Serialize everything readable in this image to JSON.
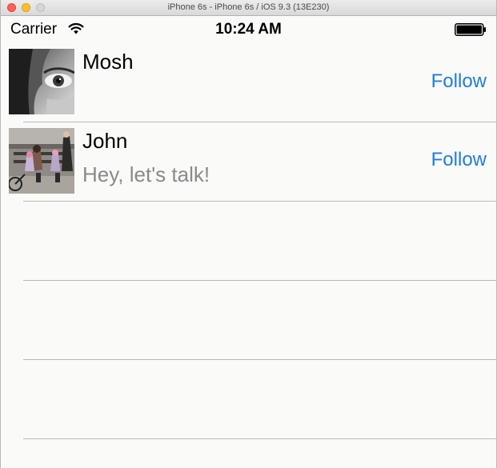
{
  "window": {
    "title": "iPhone 6s - iPhone 6s / iOS 9.3 (13E230)"
  },
  "statusbar": {
    "carrier": "Carrier",
    "time": "10:24 AM",
    "wifi_icon": "wifi-icon",
    "battery_icon": "battery-icon"
  },
  "contacts": [
    {
      "name": "Mosh",
      "message": "",
      "follow_label": "Follow",
      "avatar": "face-closeup-photo"
    },
    {
      "name": "John",
      "message": "Hey, let's talk!",
      "follow_label": "Follow",
      "avatar": "street-scene-photo"
    }
  ],
  "colors": {
    "accent": "#1f7de0",
    "secondary_text": "#8a8a8a",
    "separator": "#b8b8b8",
    "background": "#fafaf9"
  }
}
